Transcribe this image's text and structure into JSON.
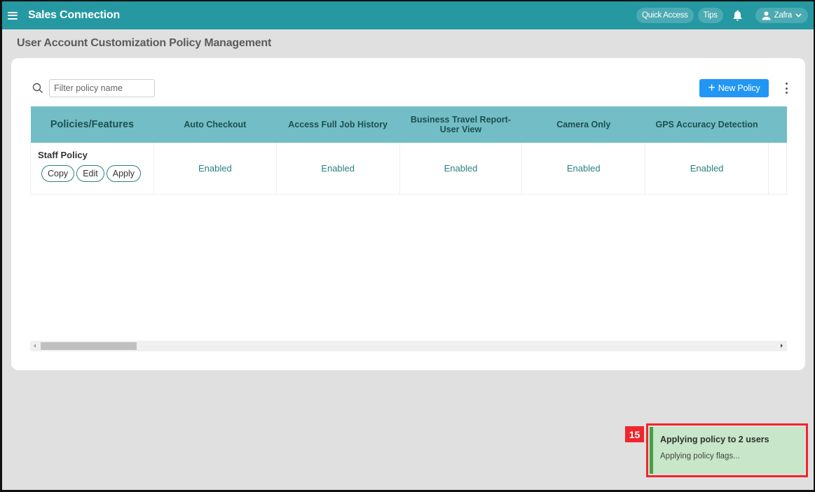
{
  "app": {
    "title": "Sales Connection",
    "quick_access_label": "Quick Access",
    "tips_label": "Tips",
    "user_name": "Zafra"
  },
  "page": {
    "title": "User Account Customization Policy Management"
  },
  "toolbar": {
    "filter_placeholder": "Filter policy name",
    "filter_value": "",
    "new_policy_label": "New Policy"
  },
  "table": {
    "columns": [
      "Policies/Features",
      "Auto Checkout",
      "Access Full Job History",
      "Business Travel Report-User View",
      "Camera Only",
      "GPS Accuracy Detection"
    ],
    "rows": [
      {
        "policy": "Staff Policy",
        "actions": [
          "Copy",
          "Edit",
          "Apply"
        ],
        "values": [
          "Enabled",
          "Enabled",
          "Enabled",
          "Enabled",
          "Enabled"
        ]
      }
    ],
    "horizontal_scroll_position": 0
  },
  "toast": {
    "badge": "15",
    "title": "Applying policy to 2 users",
    "message": "Applying policy flags...",
    "accent": "#43a047",
    "background": "#c8e6c9",
    "highlight_color": "#f0262d"
  },
  "colors": {
    "topbar": "#2598a2",
    "table_header": "#73bec6",
    "primary_button": "#2196f3"
  }
}
